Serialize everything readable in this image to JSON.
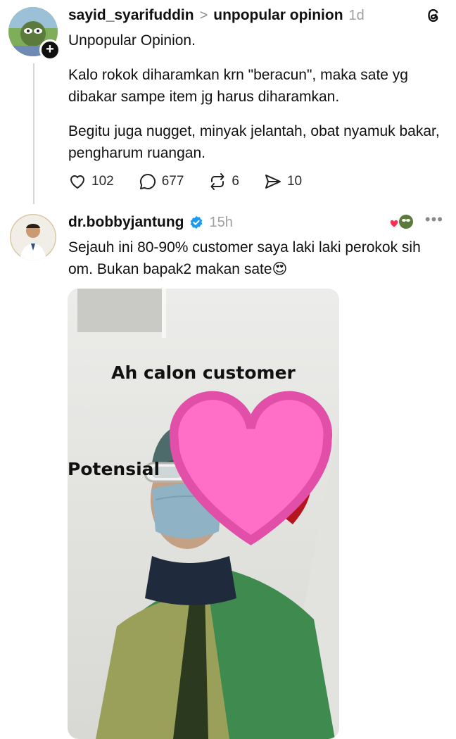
{
  "post1": {
    "username": "sayid_syarifuddin",
    "separator": ">",
    "topic": "unpopular opinion",
    "time": "1d",
    "paragraphs": [
      "Unpopular Opinion.",
      "Kalo rokok diharamkan krn \"beracun\", maka sate yg dibakar sampe item jg harus diharamkan.",
      "Begitu juga nugget, minyak jelantah, obat nyamuk bakar, pengharum ruangan."
    ],
    "actions": {
      "likes": "102",
      "comments": "677",
      "reposts": "6",
      "shares": "10"
    },
    "follow_badge": "+"
  },
  "post2": {
    "username": "dr.bobbyjantung",
    "time": "15h",
    "more": "•••",
    "text": "Sejauh ini 80-90% customer saya laki laki perokok sih om. Bukan bapak2 makan sate😍",
    "media_caption_line1": "Ah calon customer",
    "media_caption_line2": "Potensial"
  },
  "colors": {
    "text": "#101010",
    "muted": "#a0a0a0",
    "verified": "#1d9bf0",
    "thread_line": "#d6d6d6"
  },
  "icons": {
    "threads": "threads-logo-icon",
    "like": "heart-outline-icon",
    "comment": "speech-bubble-icon",
    "repost": "repost-arrows-icon",
    "share": "paper-plane-icon",
    "verified": "verified-badge-icon",
    "more": "more-dots-icon"
  }
}
